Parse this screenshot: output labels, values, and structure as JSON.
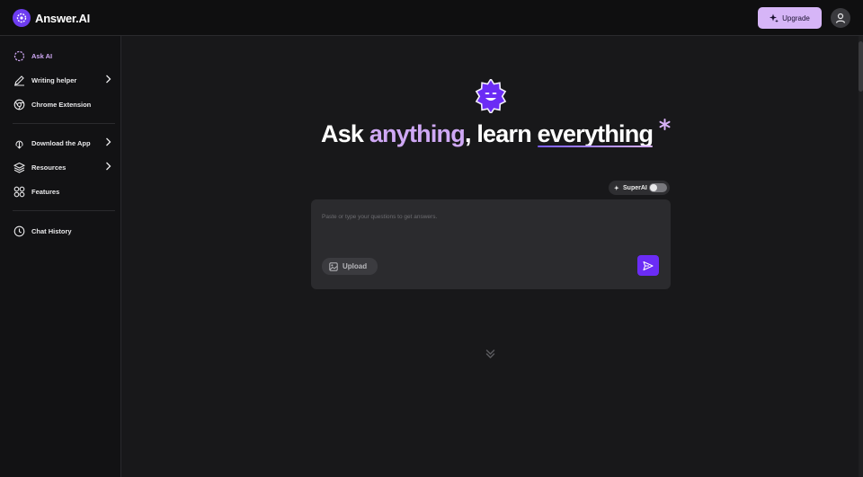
{
  "app": {
    "name": "Answer.AI"
  },
  "header": {
    "upgrade_label": "Upgrade"
  },
  "sidebar": {
    "items": [
      {
        "label": "Ask AI",
        "icon": "ask-ai-icon",
        "active": true
      },
      {
        "label": "Writing helper",
        "icon": "pen-icon",
        "has_submenu": true
      },
      {
        "label": "Chrome Extension",
        "icon": "chrome-icon"
      },
      {
        "label": "Download the App",
        "icon": "download-icon",
        "has_submenu": true
      },
      {
        "label": "Resources",
        "icon": "layers-icon",
        "has_submenu": true
      },
      {
        "label": "Features",
        "icon": "grid-icon"
      },
      {
        "label": "Chat History",
        "icon": "clock-icon"
      }
    ]
  },
  "hero": {
    "part1": "Ask",
    "part2": "anything",
    "part3": ", learn",
    "part4": "everything"
  },
  "superai": {
    "label": "SuperAI",
    "enabled": false
  },
  "prompt": {
    "placeholder": "Paste or type your questions to get answers.",
    "upload_label": "Upload"
  },
  "colors": {
    "accent": "#cfa8f5",
    "brand": "#6d3cf0",
    "send_button": "#6b2cf5",
    "background": "#18181a"
  }
}
